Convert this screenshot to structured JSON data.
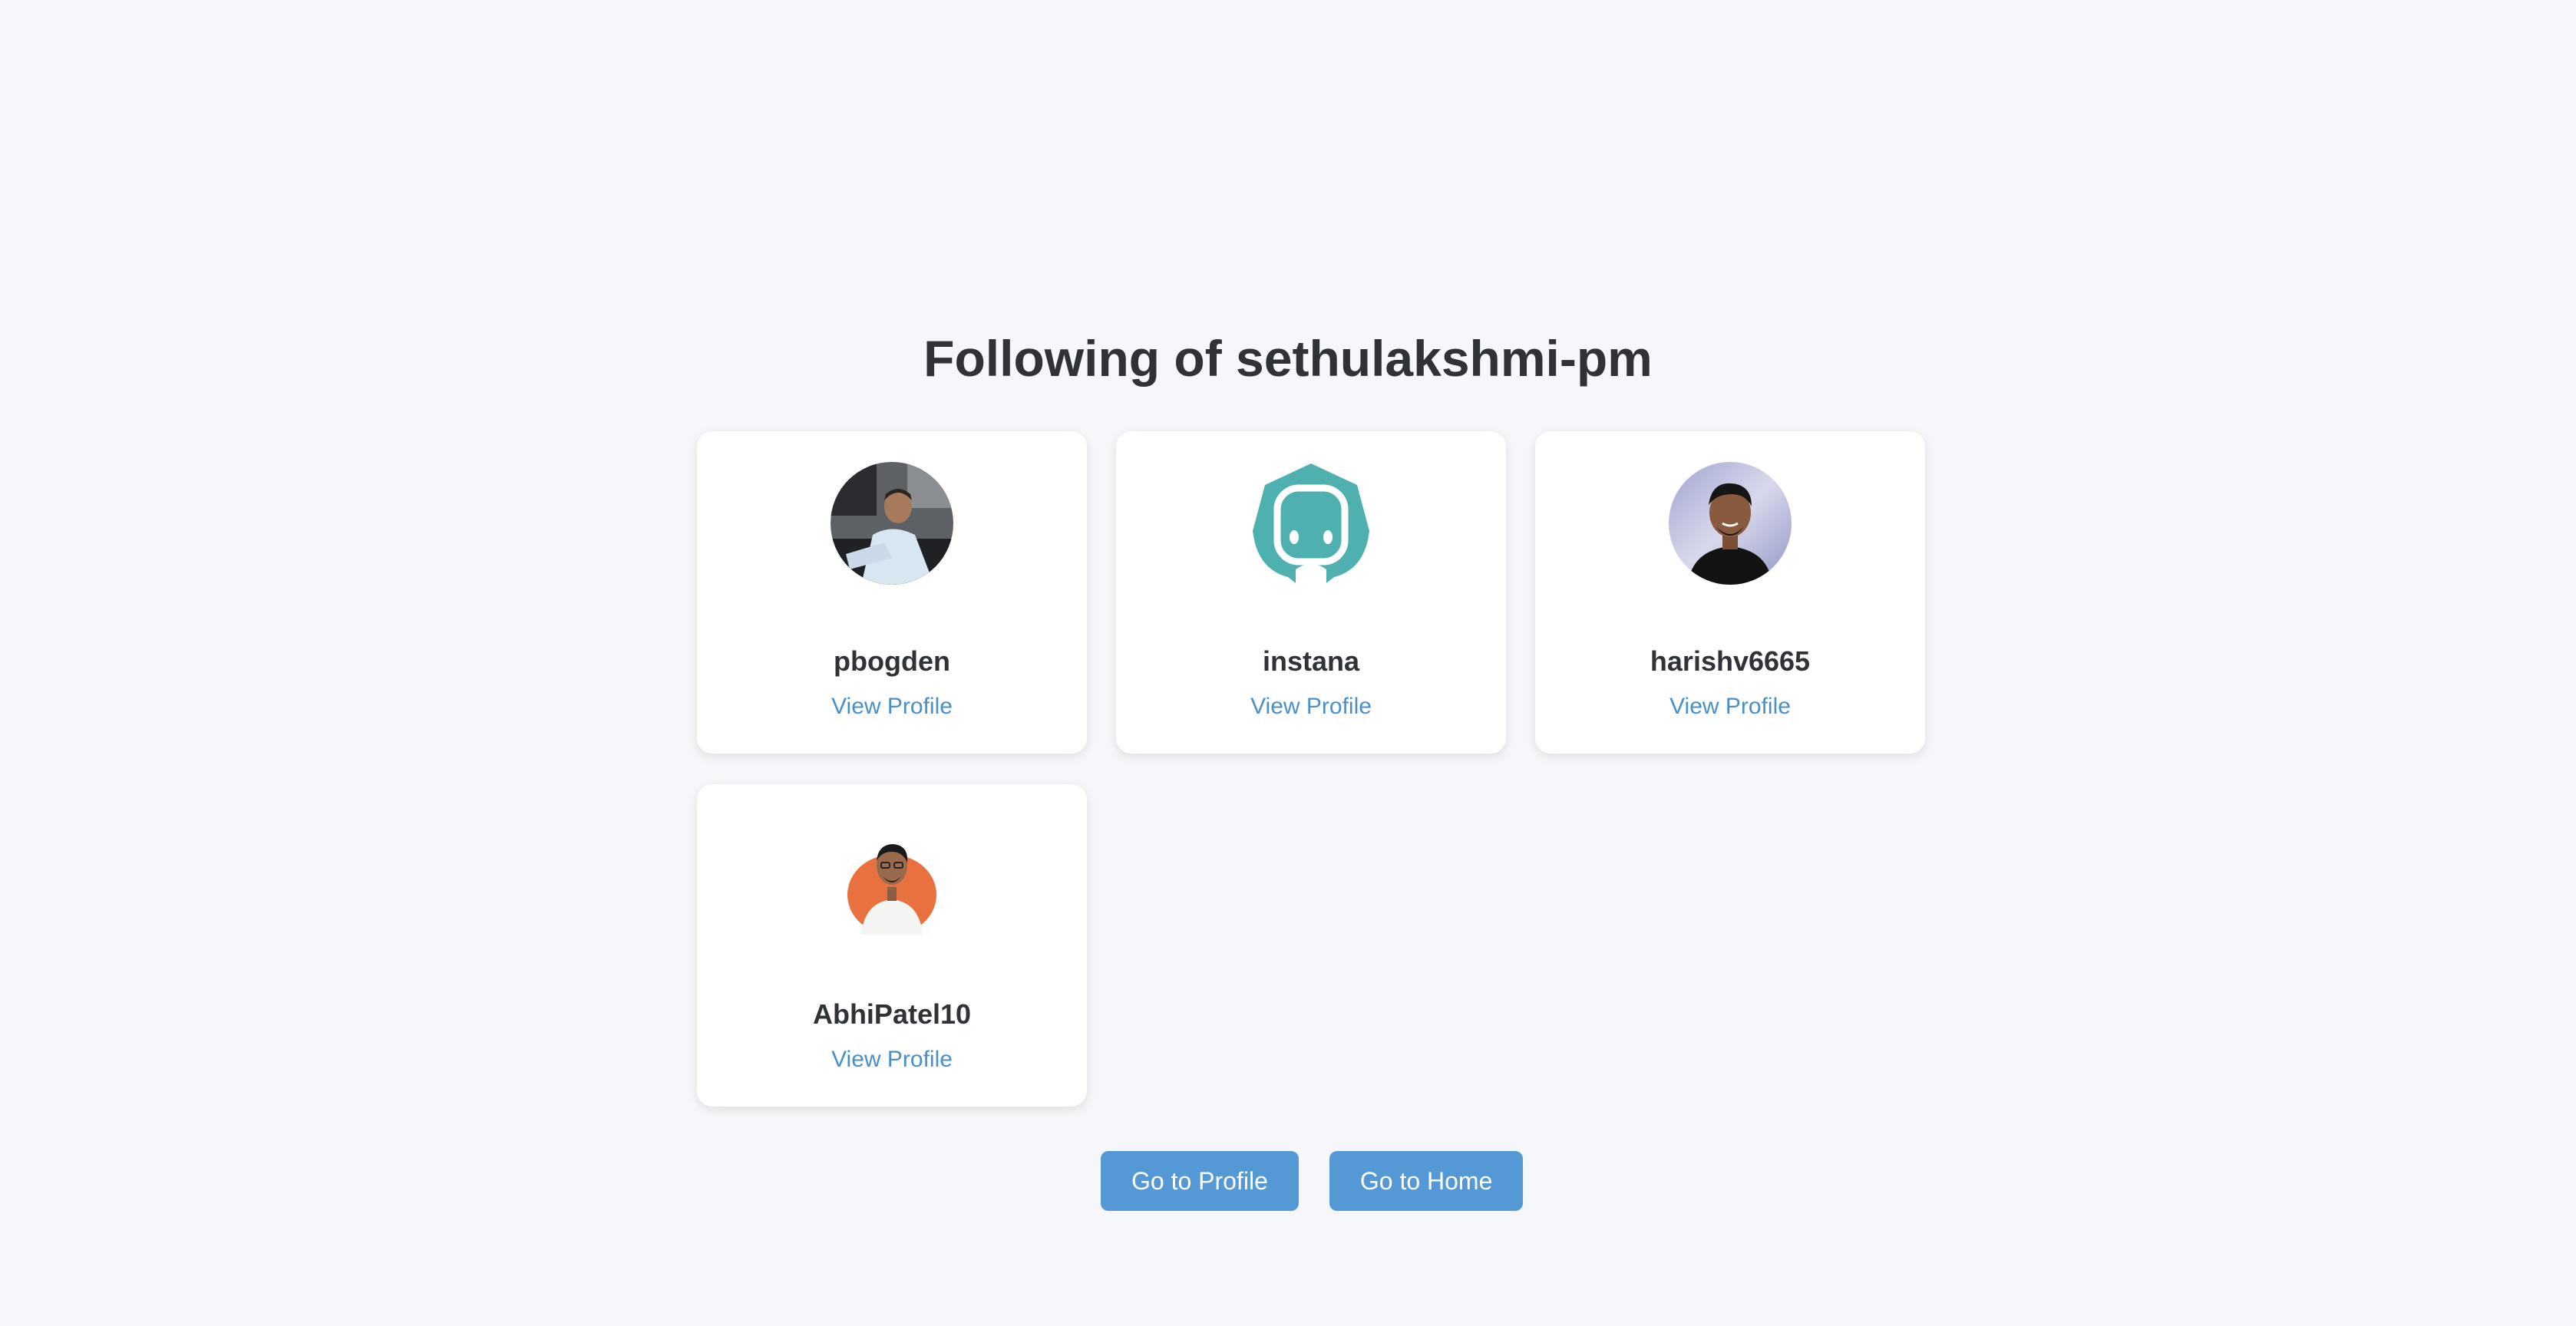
{
  "page": {
    "title": "Following of sethulakshmi-pm"
  },
  "following": [
    {
      "username": "pbogden",
      "link_label": "View Profile",
      "avatar": "photo-man-at-desk-avatar"
    },
    {
      "username": "instana",
      "link_label": "View Profile",
      "avatar": "instana-robot-logo-avatar"
    },
    {
      "username": "harishv6665",
      "link_label": "View Profile",
      "avatar": "photo-smiling-man-avatar"
    },
    {
      "username": "AbhiPatel10",
      "link_label": "View Profile",
      "avatar": "photo-man-orange-background-avatar"
    }
  ],
  "actions": {
    "go_to_profile": "Go to Profile",
    "go_to_home": "Go to Home"
  },
  "colors": {
    "background": "#f5f7fa",
    "card": "#ffffff",
    "link": "#4a90c8",
    "button": "#5499d5",
    "instana_teal": "#4fb0b0",
    "abhi_bg_orange": "#e9703f"
  }
}
